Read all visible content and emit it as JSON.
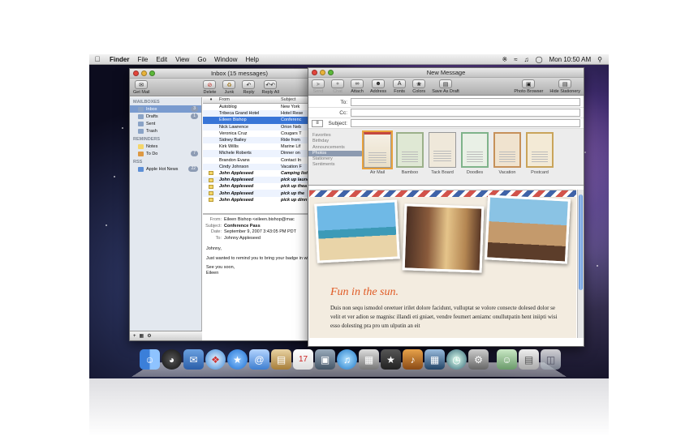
{
  "menubar": {
    "app": "Finder",
    "items": [
      "File",
      "Edit",
      "View",
      "Go",
      "Window",
      "Help"
    ],
    "clock": "Mon 10:50 AM"
  },
  "mail": {
    "title": "Inbox (15 messages)",
    "toolbar": [
      "Get Mail",
      "Delete",
      "Junk",
      "Reply",
      "Reply All"
    ],
    "sidebar": {
      "mailboxes_header": "MAILBOXES",
      "mailboxes": [
        {
          "label": "Inbox",
          "badge": "3"
        },
        {
          "label": "Drafts",
          "badge": "1"
        },
        {
          "label": "Sent",
          "badge": ""
        },
        {
          "label": "Trash",
          "badge": ""
        }
      ],
      "reminders_header": "REMINDERS",
      "reminders": [
        {
          "label": "Notes",
          "badge": ""
        },
        {
          "label": "To Do",
          "badge": "7"
        }
      ],
      "rss_header": "RSS",
      "rss": [
        {
          "label": "Apple Hot News",
          "badge": "22"
        }
      ]
    },
    "columns": {
      "from": "From",
      "subject": "Subject"
    },
    "messages": [
      {
        "from": "Autoblog",
        "subject": "New York"
      },
      {
        "from": "Tribeca Grand Hotel",
        "subject": "Hotel Rese"
      },
      {
        "from": "Eileen Bishop",
        "subject": "Conferenc"
      },
      {
        "from": "Nick Lawrence",
        "subject": "Orion Neb"
      },
      {
        "from": "Veronica Cruz",
        "subject": "Cougars T"
      },
      {
        "from": "Sidney Bailey",
        "subject": "Ride from"
      },
      {
        "from": "Kirk Willis",
        "subject": "Marine Lif"
      },
      {
        "from": "Michele Roberts",
        "subject": "Dinner on"
      },
      {
        "from": "Brandon Evans",
        "subject": "Contact In"
      },
      {
        "from": "Cindy Johnson",
        "subject": "Vacation F"
      },
      {
        "from": "John Appleseed",
        "subject": "Camping list"
      },
      {
        "from": "John Appleseed",
        "subject": "pick up laund"
      },
      {
        "from": "John Appleseed",
        "subject": "pick up thea"
      },
      {
        "from": "John Appleseed",
        "subject": "pick up the"
      },
      {
        "from": "John Appleseed",
        "subject": "pick up dinn"
      }
    ],
    "preview": {
      "from_label": "From:",
      "from": "Eileen Bishop <eileen.bishop@mac",
      "subject_label": "Subject:",
      "subject": "Conference Pass",
      "date_label": "Date:",
      "date": "September 9, 2007 3:43:05 PM PDT",
      "to_label": "To:",
      "to": "Johnny Appleseed",
      "greeting": "Johnny,",
      "body": "Just wanted to remind you to bring your badge in without it.",
      "signoff": "See you soon,",
      "name": "Eileen"
    }
  },
  "newmsg": {
    "title": "New Message",
    "toolbar": [
      "Send",
      "Chat",
      "Attach",
      "Address",
      "Fonts",
      "Colors",
      "Save As Draft",
      "Photo Browser",
      "Hide Stationery"
    ],
    "to_label": "To:",
    "cc_label": "Cc:",
    "subject_label": "Subject:",
    "categories": [
      "Favorites",
      "Birthday",
      "Announcements",
      "Photos",
      "Stationery",
      "Sentiments"
    ],
    "stationery": [
      "Air Mail",
      "Bamboo",
      "Tack Board",
      "Doodles",
      "Vacation",
      "Postcard"
    ],
    "heading": "Fun in the sun.",
    "body": "Duis non sequ ismodol oreetuer irilet dolore facidunt, vulluptat se volore consecte dolesed dolor se velit et ver adion se magnisc illandi eti gniaet, vendre feumert aeniamc onullutpatin hent iniipti wisi esso dolesting pra pro um ulputin an eit"
  },
  "colors": {
    "accent": "#3875d7",
    "heading": "#e05a24"
  }
}
